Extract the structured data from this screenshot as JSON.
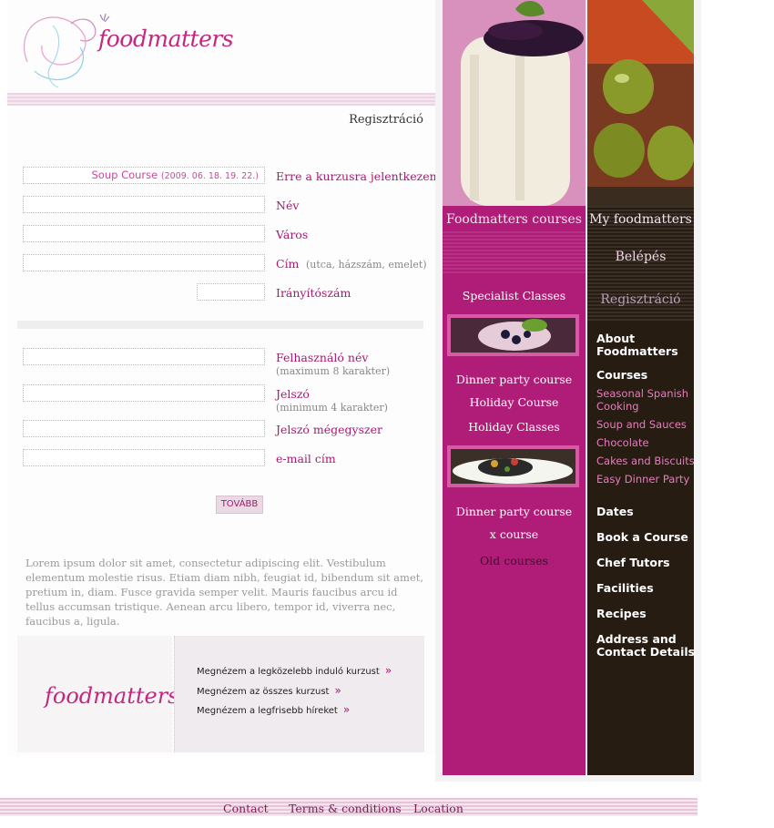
{
  "brand": {
    "logo_text": "foodmatters",
    "promo_logo_text": "foodmatters",
    "accent": "#b01d78",
    "dark": "#261c12"
  },
  "header": {
    "register_link": "Regisztráció"
  },
  "form": {
    "course_value": "Soup Course",
    "course_date": "(2009. 06. 18. 19. 22.)",
    "course_label": "Erre a kurzusra jelentkezem!",
    "name_label": "Név",
    "city_label": "Város",
    "address_label": "Cím",
    "address_hint": "(utca, házszám, emelet)",
    "zip_label": "Irányítószám",
    "username_label": "Felhasználó név",
    "username_hint": "(maximum 8 karakter)",
    "password_label": "Jelszó",
    "password_hint": "(minimum 4 karakter)",
    "password2_label": "Jelszó mégegyszer",
    "email_label": "e-mail cím",
    "submit_label": "TOVÁBB"
  },
  "body_text": "Lorem ipsum dolor sit amet, consectetur adipiscing elit. Vestibulum elementum molestie risus. Etiam diam nibh, feugiat id, bibendum sit amet, pretium in, diam. Fusce gravida semper velit. Mauris faucibus arcu id tellus accumsan tristique. Aenean arcu libero, tempor id, viverra nec, faucibus a, ligula.",
  "promo_links": [
    "Megnézem a legközelebb induló kurzust",
    "Megnézem az összes kurzust",
    "Megnézem a legfrisebb híreket"
  ],
  "tabs": {
    "courses": "Foodmatters courses",
    "my": "My foodmatters"
  },
  "pink_menu": {
    "specialist": "Specialist Classes",
    "dinner1": "Dinner party course",
    "holiday_course": "Holiday Course",
    "holiday_classes": "Holiday Classes",
    "dinner2": "Dinner party course",
    "x_course": "x course",
    "old": "Old courses"
  },
  "dark_menu": {
    "login": "Belépés",
    "register": "Regisztráció",
    "about1": "About",
    "about2": "Foodmatters",
    "courses": "Courses",
    "sub": [
      "Seasonal Spanish",
      "Cooking",
      "Soup and Sauces",
      "Chocolate",
      "Cakes and Biscuits",
      "Easy Dinner Party"
    ],
    "dates": "Dates",
    "book": "Book a Course",
    "chef": "Chef Tutors",
    "facilities": "Facilities",
    "recipes": "Recipes",
    "address1": "Address and",
    "address2": "Contact Details"
  },
  "footer": {
    "contact": "Contact",
    "terms": "Terms & conditions",
    "location": "Location"
  }
}
